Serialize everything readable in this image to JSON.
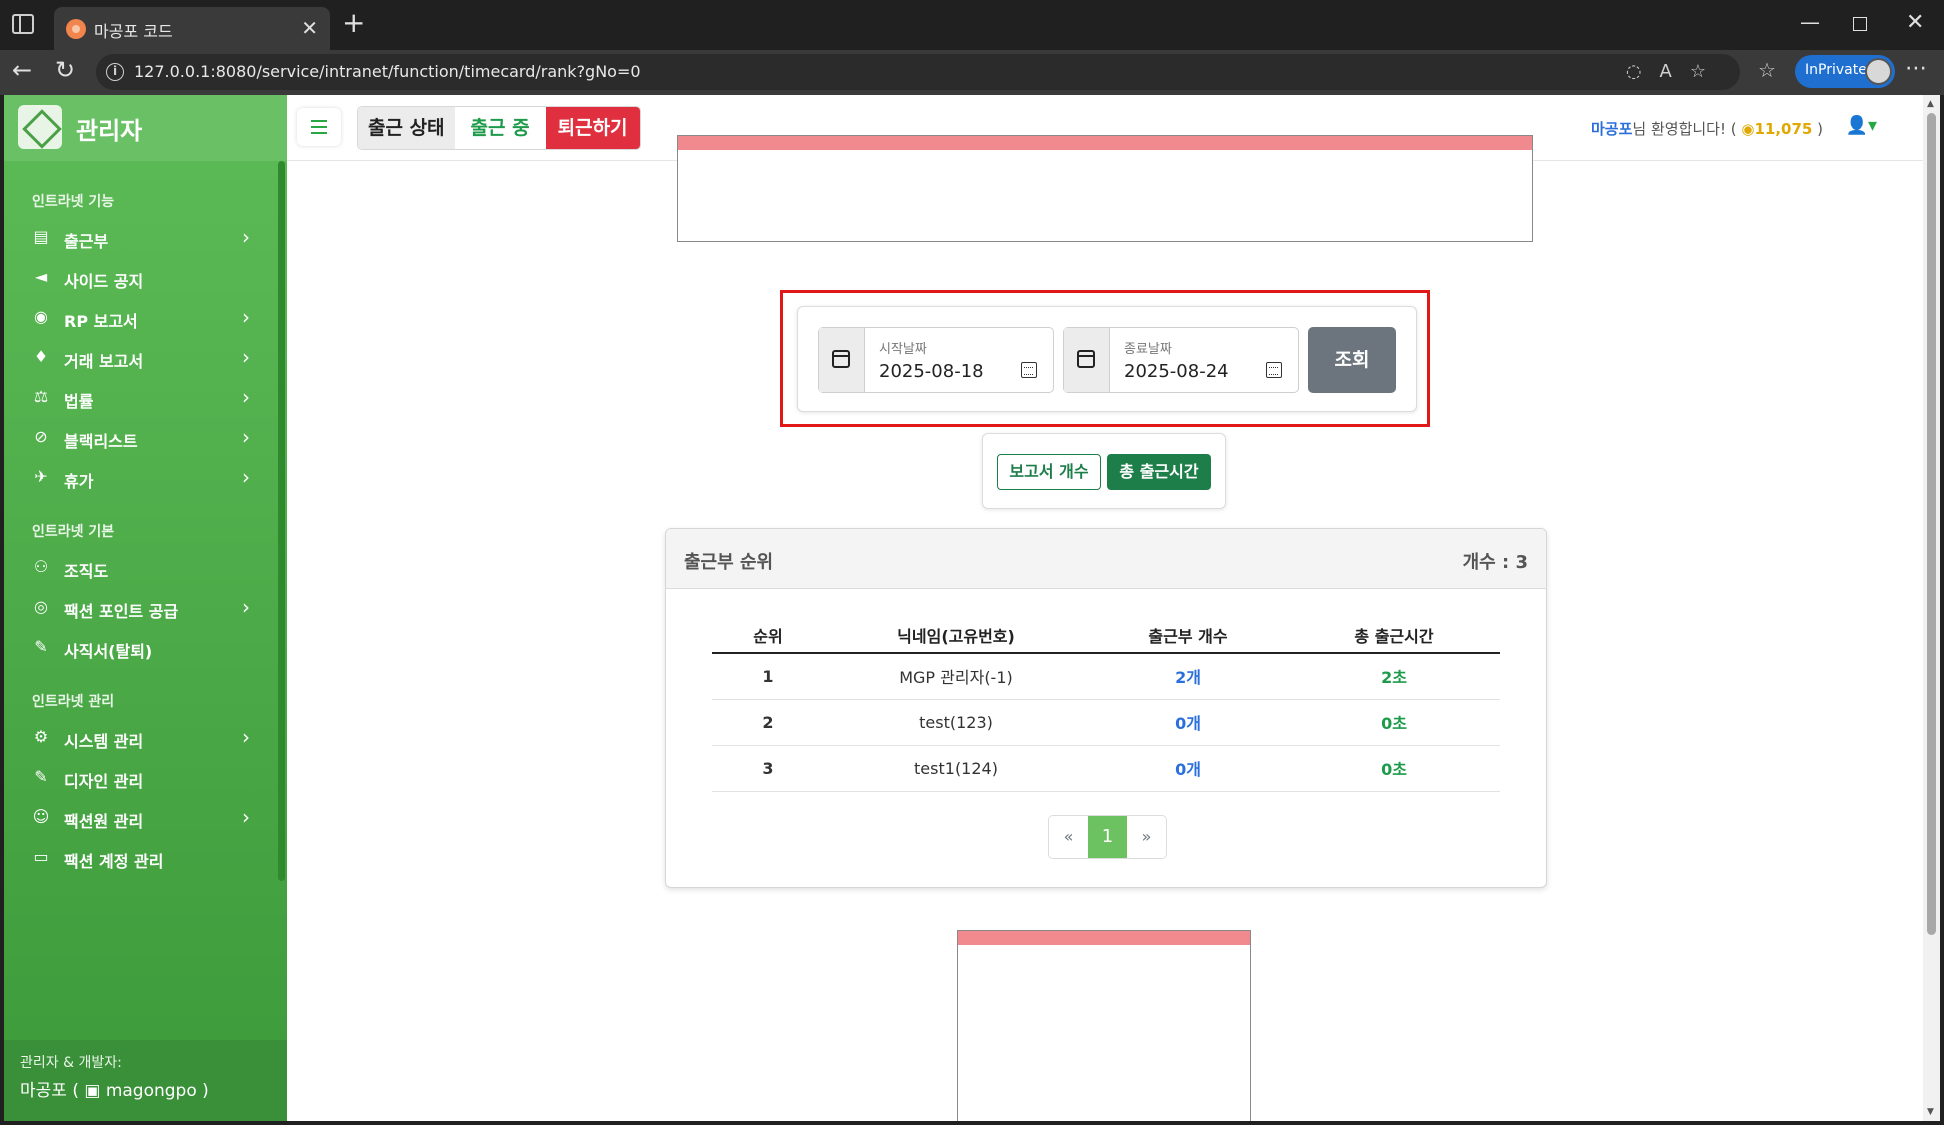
{
  "browser": {
    "tab_title": "마공포 코드",
    "url": "127.0.0.1:8080/service/intranet/function/timecard/rank?gNo=0",
    "inprivate_label": "InPrivate"
  },
  "sidebar": {
    "brand": "관리자",
    "sections": [
      {
        "heading": "인트라넷 기능"
      },
      {
        "heading": "인트라넷 기본"
      },
      {
        "heading": "인트라넷 관리"
      }
    ],
    "items": [
      {
        "label": "출근부",
        "icon": "book-icon",
        "glyph": "▤",
        "chevron": true
      },
      {
        "label": "사이드 공지",
        "icon": "megaphone-icon",
        "glyph": "◄",
        "chevron": false
      },
      {
        "label": "RP 보고서",
        "icon": "mask-icon",
        "glyph": "◉",
        "chevron": true
      },
      {
        "label": "거래 보고서",
        "icon": "money-bag-icon",
        "glyph": "♦",
        "chevron": true
      },
      {
        "label": "법률",
        "icon": "scale-icon",
        "glyph": "⚖",
        "chevron": true
      },
      {
        "label": "블랙리스트",
        "icon": "ban-icon",
        "glyph": "⊘",
        "chevron": true
      },
      {
        "label": "휴가",
        "icon": "airplane-icon",
        "glyph": "✈",
        "chevron": true
      },
      {
        "label": "조직도",
        "icon": "sitemap-icon",
        "glyph": "⚇",
        "chevron": false
      },
      {
        "label": "팩션 포인트 공급",
        "icon": "coins-icon",
        "glyph": "◎",
        "chevron": true
      },
      {
        "label": "사직서(탈퇴)",
        "icon": "feather-icon",
        "glyph": "✎",
        "chevron": false
      },
      {
        "label": "시스템 관리",
        "icon": "gear-icon",
        "glyph": "⚙",
        "chevron": true
      },
      {
        "label": "디자인 관리",
        "icon": "brush-icon",
        "glyph": "✎",
        "chevron": false
      },
      {
        "label": "팩션원 관리",
        "icon": "users-gear-icon",
        "glyph": "☺",
        "chevron": true
      },
      {
        "label": "팩션 계정 관리",
        "icon": "id-card-icon",
        "glyph": "▭",
        "chevron": false
      }
    ],
    "footer": {
      "line1": "관리자 & 개발자:",
      "line2": "마공포 ( ▣ magongpo )"
    }
  },
  "topbar": {
    "status_label": "출근 상태",
    "status_state": "출근 중",
    "leave_button": "퇴근하기",
    "welcome_name": "마공포",
    "welcome_text": "님 환영합니다! (",
    "welcome_points": "11,075",
    "welcome_close": " )"
  },
  "filter": {
    "start_label": "시작날짜",
    "start_value": "2025-08-18",
    "end_label": "종료날짜",
    "end_value": "2025-08-24",
    "search_button": "조회"
  },
  "sort_toggle": {
    "reports": "보고서 개수",
    "hours": "총 출근시간"
  },
  "ranking": {
    "title": "출근부 순위",
    "count": "개수 : 3",
    "columns": [
      "순위",
      "닉네임(고유번호)",
      "출근부 개수",
      "총 출근시간"
    ],
    "rows": [
      {
        "rank": "1",
        "name": "MGP 관리자(-1)",
        "reports": "2개",
        "hours": "2초"
      },
      {
        "rank": "2",
        "name": "test(123)",
        "reports": "0개",
        "hours": "0초"
      },
      {
        "rank": "3",
        "name": "test1(124)",
        "reports": "0개",
        "hours": "0초"
      }
    ],
    "pagination": {
      "prev": "«",
      "current": "1",
      "next": "»"
    }
  },
  "colors": {
    "sidebar_green": "#4caf50",
    "accent_green": "#1e7e4a",
    "danger": "#e02f3f",
    "highlight_outline": "#e01818"
  }
}
